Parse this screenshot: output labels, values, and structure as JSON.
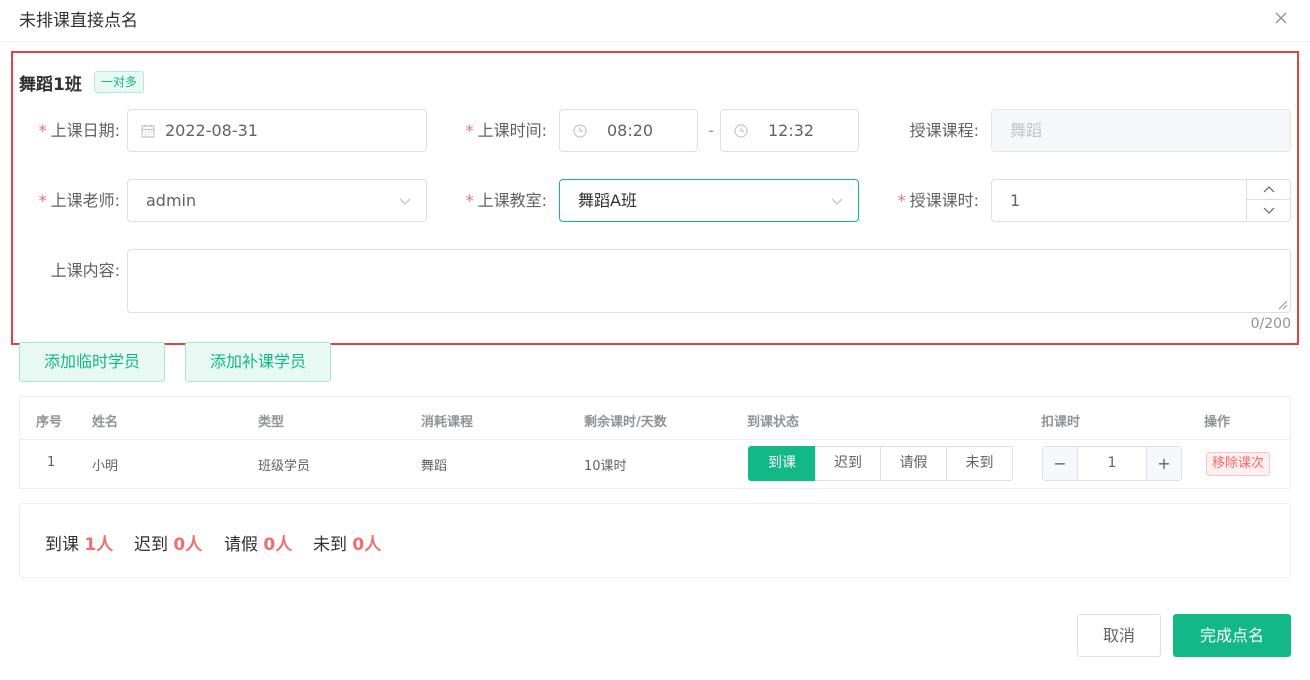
{
  "dialog": {
    "title": "未排课直接点名"
  },
  "class": {
    "name": "舞蹈1班",
    "tag": "一对多"
  },
  "form": {
    "date_label": "上课日期:",
    "date_value": "2022-08-31",
    "time_label": "上课时间:",
    "time_start": "08:20",
    "time_sep": "-",
    "time_end": "12:32",
    "course_label": "授课课程:",
    "course_value": "舞蹈",
    "teacher_label": "上课老师:",
    "teacher_value": "admin",
    "room_label": "上课教室:",
    "room_value": "舞蹈A班",
    "hours_label": "授课课时:",
    "hours_value": "1",
    "content_label": "上课内容:",
    "content_counter": "0/200",
    "required_mark": "*"
  },
  "actions": {
    "add_temp": "添加临时学员",
    "add_makeup": "添加补课学员"
  },
  "table": {
    "headers": [
      "序号",
      "姓名",
      "类型",
      "消耗课程",
      "剩余课时/天数",
      "到课状态",
      "扣课时",
      "操作"
    ],
    "rows": [
      {
        "index": "1",
        "name": "小明",
        "type": "班级学员",
        "course": "舞蹈",
        "remaining": "10课时",
        "status_options": [
          "到课",
          "迟到",
          "请假",
          "未到"
        ],
        "status_active": "到课",
        "deduct": "1",
        "action": "移除课次"
      }
    ]
  },
  "summary": {
    "present_label": "到课",
    "present_count": "1人",
    "late_label": "迟到",
    "late_count": "0人",
    "leave_label": "请假",
    "leave_count": "0人",
    "absent_label": "未到",
    "absent_count": "0人"
  },
  "footer": {
    "cancel": "取消",
    "confirm": "完成点名"
  },
  "colors": {
    "accent": "#13b887",
    "danger": "#f56c6c",
    "highlight_border": "#e0443e"
  },
  "icons": {
    "close": "close-icon",
    "calendar": "calendar-icon",
    "clock": "clock-icon",
    "chevron": "chevron-down-icon"
  }
}
